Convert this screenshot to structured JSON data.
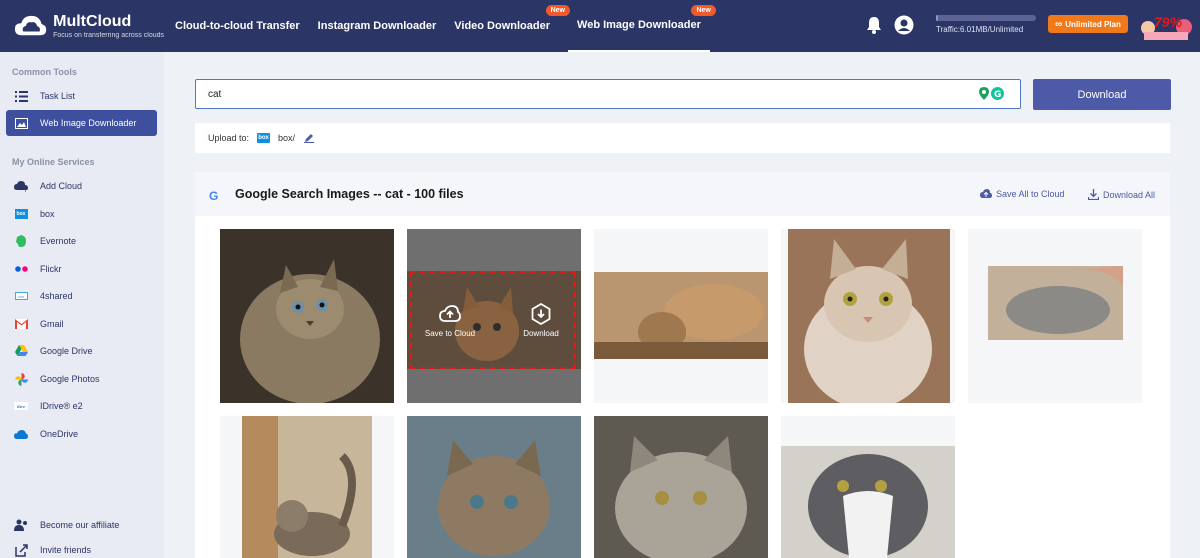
{
  "brand": {
    "name": "MultCloud",
    "tagline": "Focus on transferring across clouds"
  },
  "nav": [
    {
      "label": "Cloud-to-cloud Transfer",
      "badge": ""
    },
    {
      "label": "Instagram Downloader",
      "badge": ""
    },
    {
      "label": "Video Downloader",
      "badge": "New"
    },
    {
      "label": "Web Image Downloader",
      "badge": "New",
      "active": true
    }
  ],
  "header": {
    "traffic": "Traffic:6.01MB/Unlimited",
    "traffic_progress": 0.01,
    "plan_button": "Unlimited Plan",
    "promo_text": "79%"
  },
  "sidebar": {
    "section_tools": "Common Tools",
    "tools": [
      {
        "label": "Task List",
        "icon": "list-icon"
      },
      {
        "label": "Web Image Downloader",
        "icon": "image-icon",
        "active": true
      }
    ],
    "section_services": "My Online Services",
    "services": [
      {
        "label": "Add Cloud",
        "icon": "add-cloud-icon"
      },
      {
        "label": "box",
        "icon": "box-icon"
      },
      {
        "label": "Evernote",
        "icon": "evernote-icon"
      },
      {
        "label": "Flickr",
        "icon": "flickr-icon"
      },
      {
        "label": "4shared",
        "icon": "4shared-icon"
      },
      {
        "label": "Gmail",
        "icon": "gmail-icon"
      },
      {
        "label": "Google Drive",
        "icon": "google-drive-icon"
      },
      {
        "label": "Google Photos",
        "icon": "google-photos-icon"
      },
      {
        "label": "IDrive® e2",
        "icon": "idrive-icon"
      },
      {
        "label": "OneDrive",
        "icon": "onedrive-icon"
      }
    ],
    "bottom": [
      {
        "label": "Become our affiliate",
        "icon": "affiliate-icon"
      },
      {
        "label": "Invite friends",
        "icon": "invite-icon"
      }
    ]
  },
  "search": {
    "value": "cat",
    "button": "Download"
  },
  "upload": {
    "label": "Upload to:",
    "path": "box/"
  },
  "results": {
    "google_letter": "G",
    "title": "Google Search Images -- cat - 100 files",
    "save_all": "Save All to Cloud",
    "download_all": "Download All",
    "hover_save": "Save to Cloud",
    "hover_download": "Download"
  },
  "colors": {
    "navbar": "#2b3566",
    "accent": "#4c5aa8",
    "badge": "#f0592b",
    "plan": "#f07a1b",
    "hover_border": "#e3191a"
  }
}
